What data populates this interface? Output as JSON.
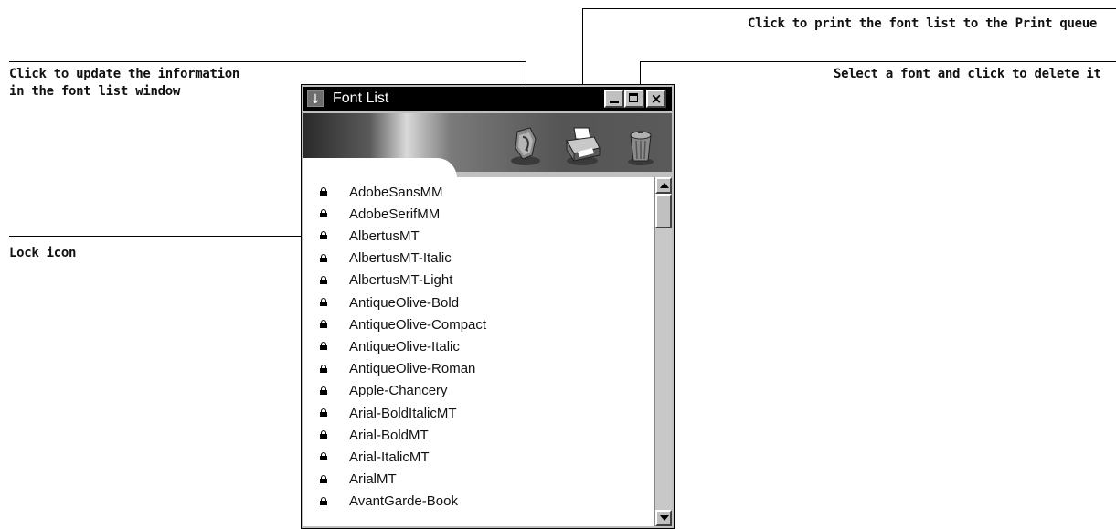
{
  "callouts": {
    "print": "Click to print the font list to the Print queue",
    "update_line1": "Click to update the information",
    "update_line2": "in the font list window",
    "delete": "Select a font and click to delete it",
    "lock": "Lock icon"
  },
  "window": {
    "title": "Font List",
    "sysmenu_glyph": "↓",
    "close_glyph": "×"
  },
  "toolbar": {
    "icons": [
      "refresh-icon",
      "printer-icon",
      "trash-icon"
    ]
  },
  "font_list": [
    "AdobeSansMM",
    "AdobeSerifMM",
    "AlbertusMT",
    "AlbertusMT-Italic",
    "AlbertusMT-Light",
    "AntiqueOlive-Bold",
    "AntiqueOlive-Compact",
    "AntiqueOlive-Italic",
    "AntiqueOlive-Roman",
    "Apple-Chancery",
    "Arial-BoldItalicMT",
    "Arial-BoldMT",
    "Arial-ItalicMT",
    "ArialMT",
    "AvantGarde-Book"
  ],
  "colors": {
    "titlebar": "#000000",
    "window_chrome": "#c0c0c0",
    "list_bg": "#ffffff"
  }
}
